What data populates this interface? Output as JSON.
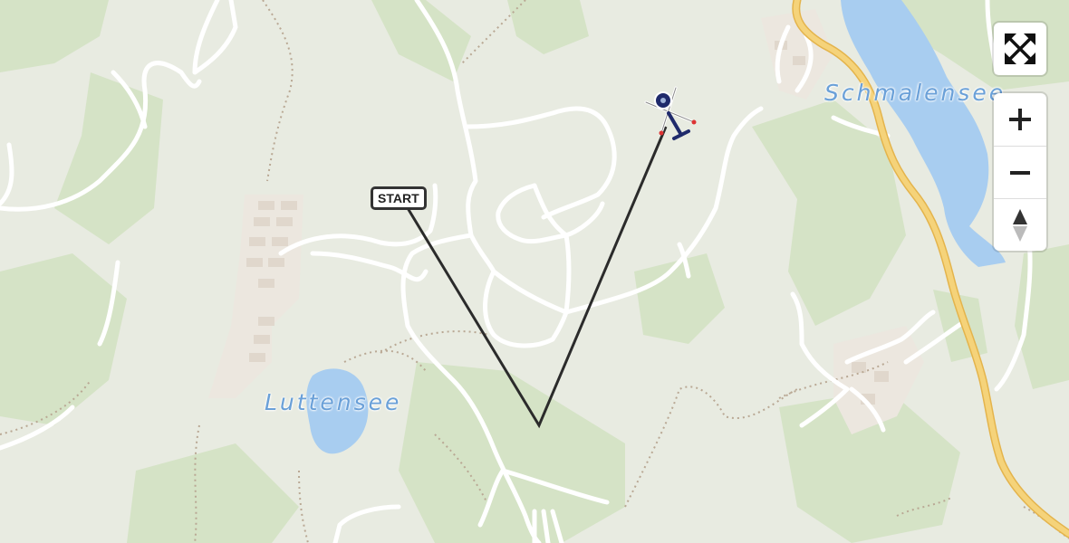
{
  "map": {
    "labels": {
      "luttensee": "Luttensee",
      "schmalensee": "Schmalensee"
    },
    "start_marker": "START",
    "route_color": "#2b2b2b",
    "lake_color": "#a8cdf0",
    "forest_color": "#d5e3c6",
    "highway_color": "#f5d37a"
  },
  "controls": {
    "fullscreen": "fullscreen-icon",
    "zoom_in": "plus-icon",
    "zoom_out": "minus-icon",
    "compass": "compass-icon"
  },
  "aircraft": {
    "type": "helicopter-icon"
  }
}
